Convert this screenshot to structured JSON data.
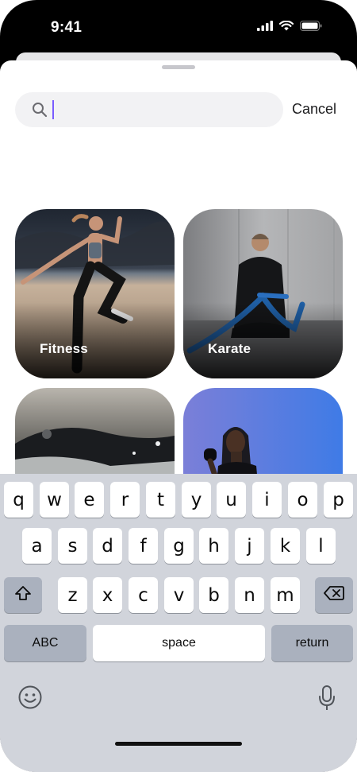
{
  "status_bar": {
    "time": "9:41"
  },
  "search": {
    "value": "",
    "cancel_label": "Cancel"
  },
  "categories": [
    {
      "label": "Fitness"
    },
    {
      "label": "Karate"
    },
    {
      "label": ""
    },
    {
      "label": ""
    }
  ],
  "keyboard": {
    "row1": [
      "q",
      "w",
      "e",
      "r",
      "t",
      "y",
      "u",
      "i",
      "o",
      "p"
    ],
    "row2": [
      "a",
      "s",
      "d",
      "f",
      "g",
      "h",
      "j",
      "k",
      "l"
    ],
    "row3": [
      "z",
      "x",
      "c",
      "v",
      "b",
      "n",
      "m"
    ],
    "abc_label": "ABC",
    "space_label": "space",
    "return_label": "return"
  },
  "icons": {
    "signal": "cellular-signal-icon",
    "wifi": "wifi-icon",
    "battery": "battery-icon",
    "search": "search-icon",
    "shift": "shift-icon",
    "delete": "backspace-icon",
    "emoji": "emoji-icon",
    "mic": "microphone-icon"
  }
}
